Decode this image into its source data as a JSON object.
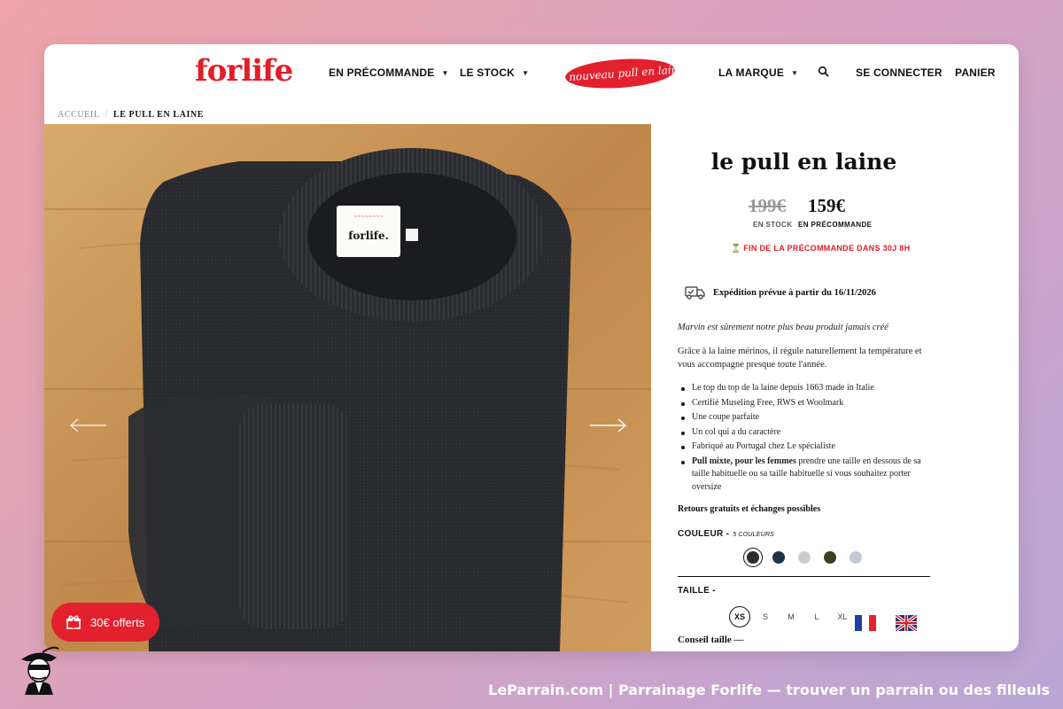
{
  "header": {
    "logo": "forlife",
    "nav": {
      "precommande": "EN PRÉCOMMANDE",
      "stock": "LE STOCK",
      "marque": "LA MARQUE",
      "connect": "SE CONNECTER",
      "cart": "PANIER"
    },
    "promo": "le nouveau pull en laine",
    "search_icon": "search-icon"
  },
  "breadcrumb": {
    "home": "ACCUEIL",
    "separator": "/",
    "current": "LE PULL EN LAINE"
  },
  "product": {
    "title": "le pull en laine",
    "old_price": "199€",
    "new_price": "159€",
    "old_price_label": "EN STOCK",
    "new_price_label": "EN PRÉCOMMANDE",
    "countdown": "⏳ FIN DE LA PRÉCOMMANDE DANS 30J 8H",
    "shipping": "Expédition prévue à partir du 16/11/2026",
    "tagline": "Marvin est sûrement notre plus beau produit jamais créé",
    "intro": "Grâce à la laine mérinos, il régule naturellement la température et vous accompagne presque toute l'année.",
    "features": [
      "Le top du top de la laine depuis 1663 made in Italie",
      "Certifié Museling Free, RWS et Woolmark",
      "Une coupe parfaite",
      "Un col qui a du caractère",
      "Fabriqué au Portugal chez Le spécialiste"
    ],
    "feature_mixte_bold": "Pull mixte, pour les femmes",
    "feature_mixte_rest": " prendre une taille en dessous de sa taille habituelle ou sa taille habituelle si vous souhaitez porter oversize",
    "returns": "Retours gratuits et échanges possibles",
    "color_label": "COULEUR -",
    "color_count": "5 COULEURS",
    "colors": [
      "#2c2c2e",
      "#1f3448",
      "#cdcdd0",
      "#3a3f22",
      "#c2cad8"
    ],
    "size_label": "TAILLE -",
    "sizes": [
      "XS",
      "S",
      "M",
      "L",
      "XL"
    ],
    "selected_size": "XS",
    "conseil": "Conseil taille —",
    "label_tag_brand": "forlife."
  },
  "gift_button": {
    "label": "30€ offerts",
    "icon": "gift-icon"
  },
  "flags": [
    "flag-fr-icon",
    "flag-uk-icon"
  ],
  "footer": {
    "text": "LeParrain.com | Parrainage Forlife — trouver un parrain ou des filleuls"
  }
}
